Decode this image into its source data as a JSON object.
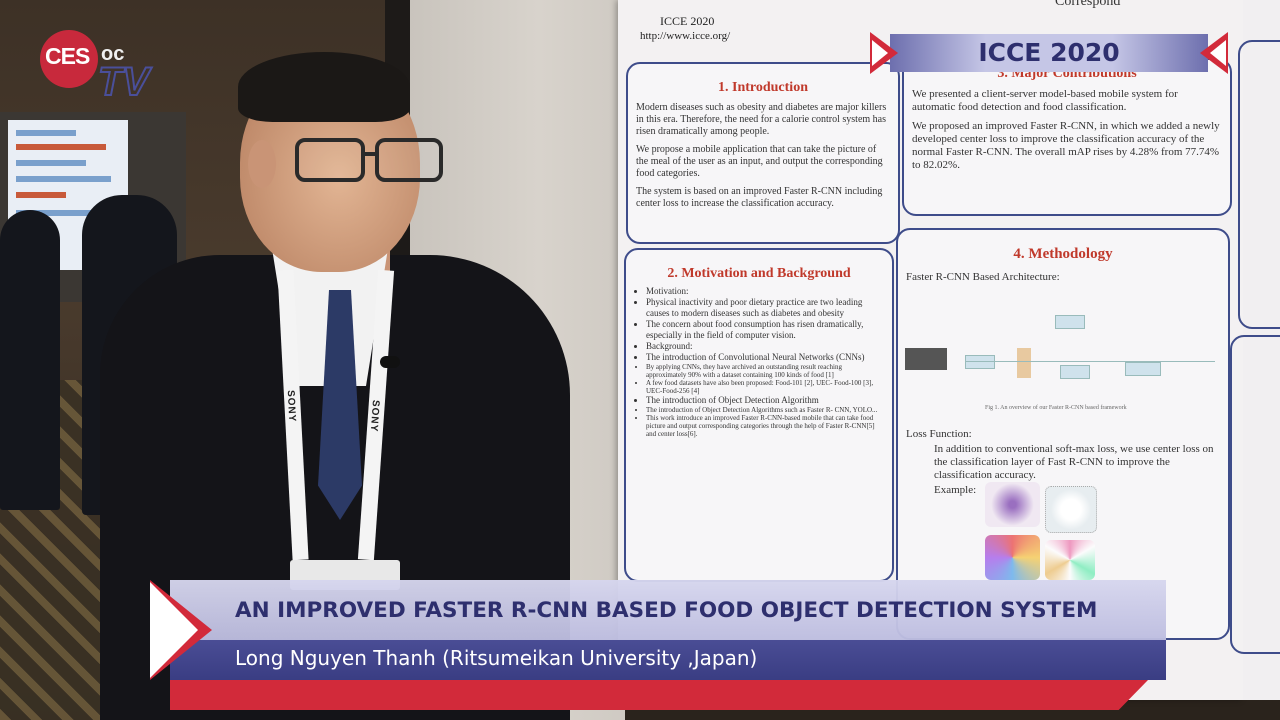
{
  "event_banner": {
    "text": "ICCE 2020"
  },
  "logo": {
    "ces": "CES",
    "oc": "oc",
    "tv": "TV"
  },
  "lower_third": {
    "title": "AN IMPROVED FASTER R-CNN BASED FOOD OBJECT DETECTION SYSTEM",
    "name": "Long Nguyen Thanh (Ritsumeikan University ,Japan)"
  },
  "lanyard": {
    "brand": "SONY"
  },
  "poster": {
    "header_title": "ICCE 2020",
    "header_url": "http://www.icce.org/",
    "header_right": "Correspond",
    "intro": {
      "heading": "1. Introduction",
      "paragraphs": [
        "Modern diseases such as obesity and diabetes are major killers in this era. Therefore, the need for a calorie control system has risen dramatically among people.",
        "We propose a mobile application that can take the picture of the meal of the user as an input, and output the corresponding food categories.",
        "The system is based on an improved Faster R-CNN including center loss to increase the classification accuracy."
      ]
    },
    "contrib": {
      "heading": "3. Major Contributions",
      "paragraphs": [
        "We presented a client-server model-based mobile system for automatic food detection and food classification.",
        "We proposed an improved Faster R-CNN, in which we added a newly developed center loss to improve the classification accuracy of the normal Faster R-CNN. The overall mAP rises by 4.28% from 77.74% to 82.02%."
      ]
    },
    "motivation": {
      "heading": "2. Motivation and Background",
      "lines": [
        "Motivation:",
        "Physical inactivity and poor dietary practice are two leading causes to modern diseases such as diabetes and obesity",
        "The concern about food consumption has risen dramatically, especially in the field of computer vision.",
        "Background:",
        "The introduction of Convolutional Neural Networks (CNNs)",
        "By applying CNNs, they have archived an outstanding result reaching approximately 90% with a dataset containing 100 kinds of food [1]",
        "A few food datasets have also been proposed: Food-101 [2], UEC- Food-100 [3], UEC-Food-256 [4]",
        "The introduction of Object Detection Algorithm",
        "The introduction of Object Detection Algorithms such as Faster R- CNN, YOLO...",
        "This work introduce an improved Faster R-CNN-based mobile that can take food picture and output corresponding categories through the help of Faster R-CNN[5] and center loss[6]."
      ]
    },
    "method": {
      "heading": "4. Methodology",
      "arch_label": "Faster R-CNN Based Architecture:",
      "fig_caption": "Fig 1. An overview of our Faster R-CNN based framework",
      "loss_label": "Loss Function:",
      "loss_text": "In addition to conventional soft-max loss, we use center loss on the classification layer of Fast R-CNN to improve the classification accuracy.",
      "example_label": "Example:"
    }
  }
}
